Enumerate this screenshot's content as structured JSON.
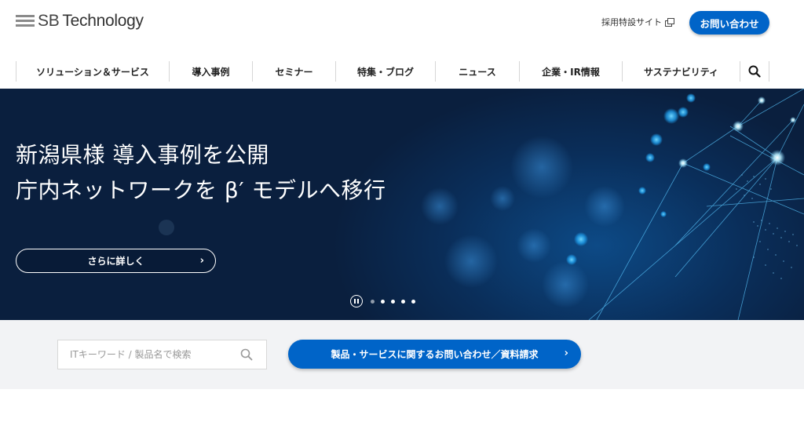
{
  "header": {
    "logo_prefix": "SB",
    "logo_name": "Technology",
    "recruit_link": "採用特設サイト",
    "contact_button": "お問い合わせ"
  },
  "nav": {
    "items": [
      {
        "label": "ソリューション＆サービス"
      },
      {
        "label": "導入事例"
      },
      {
        "label": "セミナー"
      },
      {
        "label": "特集・ブログ"
      },
      {
        "label": "ニュース"
      },
      {
        "label": "企業・IR情報"
      },
      {
        "label": "サステナビリティ"
      }
    ],
    "search_icon": "search-icon"
  },
  "hero": {
    "title_line1": "新潟県様 導入事例を公開",
    "title_line2": "庁内ネットワークを β′ モデルへ移行",
    "more_button": "さらに詳しく",
    "chevron": "›",
    "slide_count": 5,
    "active_slide": 1
  },
  "search": {
    "placeholder": "ITキーワード / 製品名で検索",
    "inquiry_button": "製品・サービスに関するお問い合わせ／資料請求",
    "chevron": "›"
  },
  "colors": {
    "accent": "#0064c8",
    "hero_bg": "#0a1f3e",
    "band_bg": "#f2f3f5"
  }
}
